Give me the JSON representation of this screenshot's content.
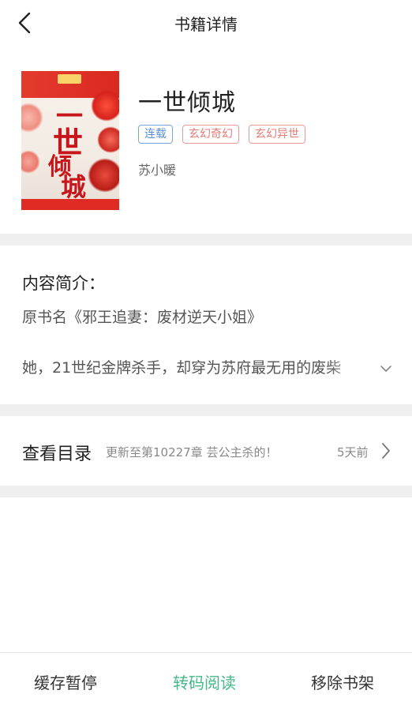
{
  "header": {
    "title": "书籍详情"
  },
  "book": {
    "cover_title": "一世倾城",
    "title": "一世倾城",
    "tags": [
      {
        "label": "连载",
        "color": "#5a8fd3"
      },
      {
        "label": "玄幻奇幻",
        "color": "#e27b76"
      },
      {
        "label": "玄幻异世",
        "color": "#e27b76"
      }
    ],
    "author": "苏小暖"
  },
  "intro": {
    "heading": "内容简介：",
    "original_title": "原书名《邪王追妻：废材逆天小姐》",
    "text": "她，21世纪金牌杀手，却穿为苏府最无用的废柴"
  },
  "catalog": {
    "label": "查看目录",
    "latest": "更新至第10227章 芸公主杀的！",
    "time": "5天前"
  },
  "bottom": {
    "cache": "缓存暂停",
    "transcode": "转码阅读",
    "remove": "移除书架"
  },
  "colors": {
    "accent": "#45b887",
    "divider": "#efefef",
    "cover_red": "#c8161d"
  }
}
